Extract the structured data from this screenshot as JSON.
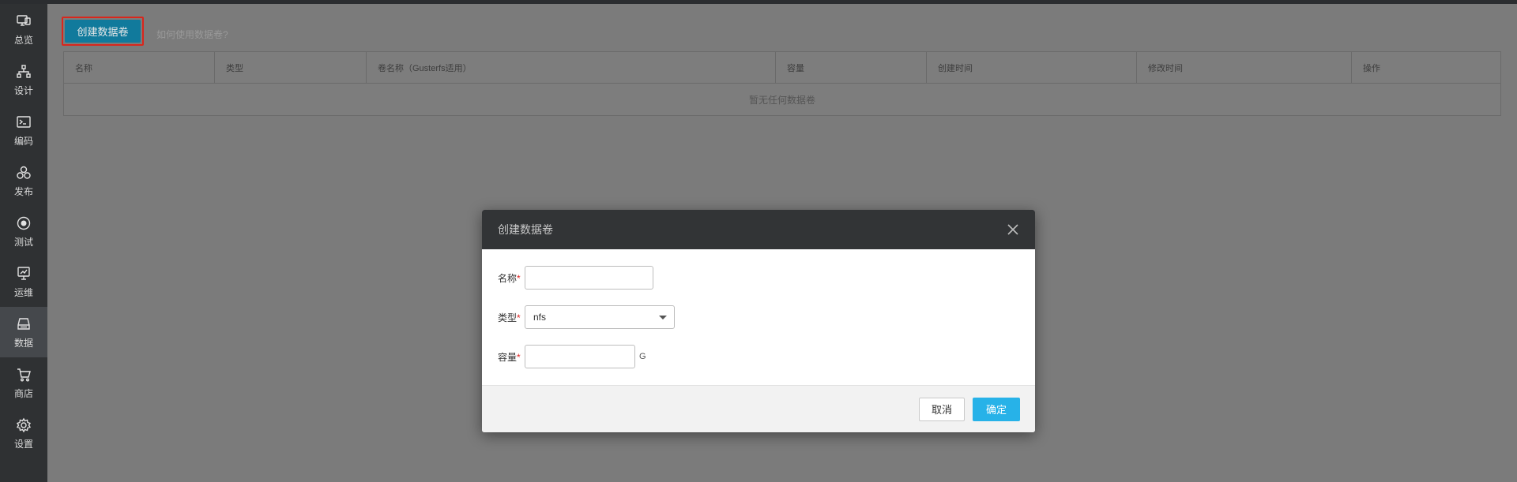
{
  "sidebar": {
    "items": [
      {
        "label": "总览",
        "icon": "monitor-icon"
      },
      {
        "label": "设计",
        "icon": "sitemap-icon"
      },
      {
        "label": "编码",
        "icon": "terminal-icon"
      },
      {
        "label": "发布",
        "icon": "cubes-icon"
      },
      {
        "label": "测试",
        "icon": "target-icon"
      },
      {
        "label": "运维",
        "icon": "monitor-chart-icon"
      },
      {
        "label": "数据",
        "icon": "database-icon"
      },
      {
        "label": "商店",
        "icon": "cart-icon"
      },
      {
        "label": "设置",
        "icon": "gear-icon"
      }
    ],
    "active": "数据"
  },
  "toolbar": {
    "create_label": "创建数据卷",
    "help_text": "如何使用数据卷?"
  },
  "table": {
    "columns": [
      "名称",
      "类型",
      "卷名称（Gusterfs适用）",
      "容量",
      "创建时间",
      "修改时间",
      "操作"
    ],
    "empty_text": "暂无任何数据卷"
  },
  "modal": {
    "title": "创建数据卷",
    "fields": {
      "name_label": "名称",
      "type_label": "类型",
      "type_value": "nfs",
      "capacity_label": "容量",
      "capacity_unit": "G",
      "required_mark": "*"
    },
    "cancel_label": "取消",
    "ok_label": "确定"
  },
  "colors": {
    "accent": "#27b2e8",
    "create_button": "#117a9c",
    "highlight_border": "#d9261c",
    "sidebar": "#2f3133"
  }
}
